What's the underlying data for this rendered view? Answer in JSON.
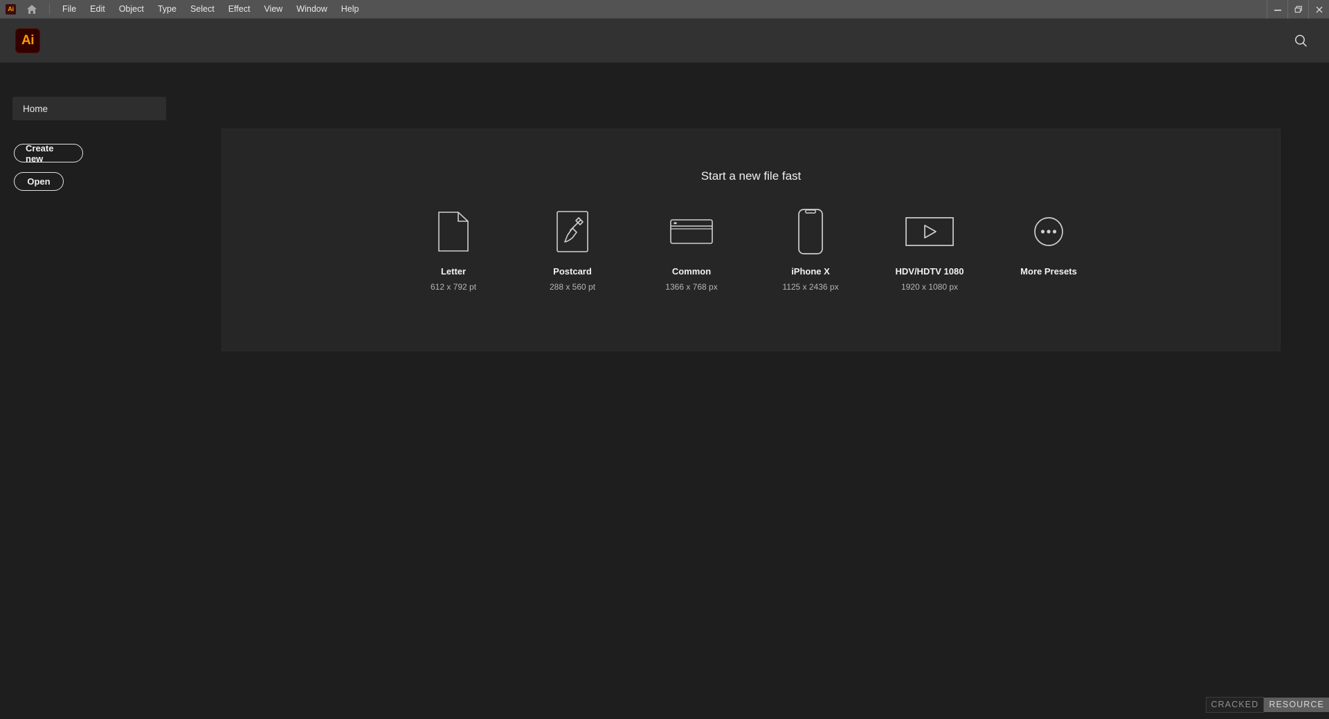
{
  "window": {
    "app_badge": "Ai",
    "controls": [
      {
        "name": "minimize-button",
        "icon": "minimize-icon"
      },
      {
        "name": "restore-button",
        "icon": "restore-icon"
      },
      {
        "name": "close-button",
        "icon": "close-icon"
      }
    ]
  },
  "menubar": {
    "home_icon": "home-icon",
    "items": [
      {
        "label": "File"
      },
      {
        "label": "Edit"
      },
      {
        "label": "Object"
      },
      {
        "label": "Type"
      },
      {
        "label": "Select"
      },
      {
        "label": "Effect"
      },
      {
        "label": "View"
      },
      {
        "label": "Window"
      },
      {
        "label": "Help"
      }
    ]
  },
  "header": {
    "logo_text": "Ai",
    "search_icon": "search-icon"
  },
  "sidebar": {
    "nav": [
      {
        "label": "Home",
        "active": true
      }
    ],
    "actions": [
      {
        "label": "Create new"
      },
      {
        "label": "Open"
      }
    ]
  },
  "main": {
    "panel_title": "Start a new file fast",
    "presets": [
      {
        "label": "Letter",
        "size": "612 x 792 pt",
        "icon": "page-document-icon"
      },
      {
        "label": "Postcard",
        "size": "288 x 560 pt",
        "icon": "paintbrush-icon"
      },
      {
        "label": "Common",
        "size": "1366 x 768 px",
        "icon": "browser-window-icon"
      },
      {
        "label": "iPhone X",
        "size": "1125 x 2436 px",
        "icon": "mobile-phone-icon"
      },
      {
        "label": "HDV/HDTV 1080",
        "size": "1920 x 1080 px",
        "icon": "video-play-icon"
      },
      {
        "label": "More Presets",
        "size": "",
        "icon": "ellipsis-circle-icon"
      }
    ]
  },
  "watermark": {
    "part1": "CRACKED",
    "part2": "RESOURCE"
  },
  "colors": {
    "titlebar_bg": "#535353",
    "header_bg": "#323232",
    "workspace_bg": "#1e1e1e",
    "panel_bg": "#262626",
    "accent_orange": "#ff9a00",
    "logo_bg": "#330000",
    "stroke": "#d0d0d0"
  }
}
